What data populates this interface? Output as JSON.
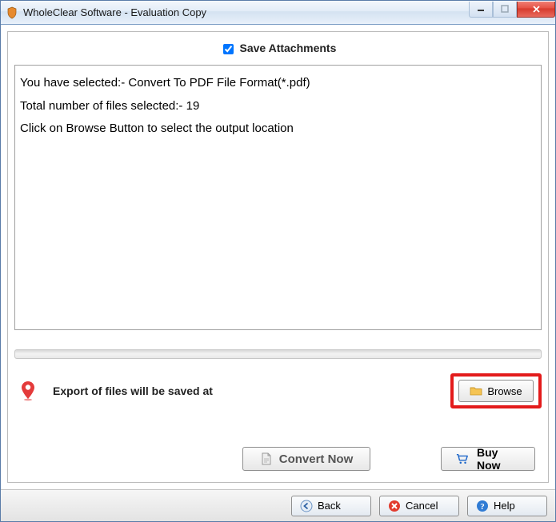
{
  "window": {
    "title": "WholeClear Software - Evaluation Copy"
  },
  "saveAttachments": {
    "label": "Save Attachments",
    "checked": true
  },
  "message": {
    "line1": "You have selected:- Convert To PDF File Format(*.pdf)",
    "line2": "Total number of files selected:- 19",
    "line3": "Click on Browse Button to select the output location"
  },
  "export": {
    "label": "Export of files will be saved at",
    "browse": "Browse"
  },
  "actions": {
    "convert": "Convert Now",
    "buy": "Buy Now"
  },
  "footer": {
    "back": "Back",
    "cancel": "Cancel",
    "help": "Help"
  }
}
